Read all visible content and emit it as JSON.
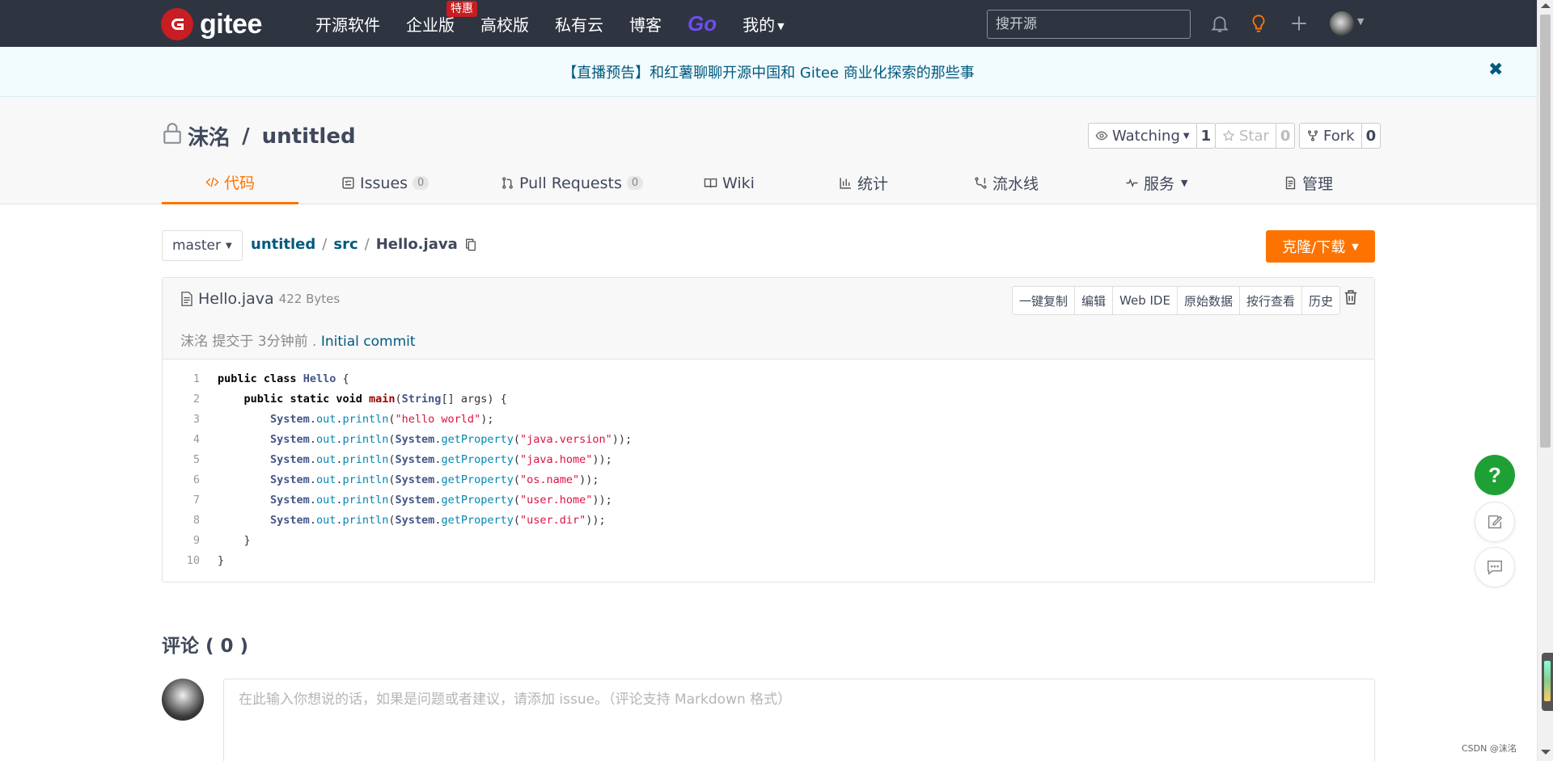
{
  "nav": {
    "logo_text": "gitee",
    "links": [
      "开源软件",
      "企业版",
      "高校版",
      "私有云",
      "博客"
    ],
    "go_label": "Go",
    "mine_label": "我的",
    "hot_badge": "特惠",
    "search_placeholder": "搜开源",
    "icons": [
      "bell-icon",
      "lightbulb-icon",
      "plus-icon",
      "avatar"
    ],
    "accent_color": "#c71d23"
  },
  "banner": {
    "text": "【直播预告】和红薯聊聊开源中国和 Gitee 商业化探索的那些事",
    "close": "✖"
  },
  "repo": {
    "owner": "沫洺",
    "name": "untitled",
    "separator": " / ",
    "watch_label": "Watching",
    "watch_count": "1",
    "star_label": "Star",
    "star_count": "0",
    "fork_label": "Fork",
    "fork_count": "0"
  },
  "tabs": [
    {
      "label": "代码",
      "icon": "code-icon",
      "active": true
    },
    {
      "label": "Issues",
      "icon": "issues-icon",
      "count": "0"
    },
    {
      "label": "Pull Requests",
      "icon": "pull-request-icon",
      "count": "0"
    },
    {
      "label": "Wiki",
      "icon": "book-icon"
    },
    {
      "label": "统计",
      "icon": "bar-chart-icon"
    },
    {
      "label": "流水线",
      "icon": "pipeline-icon"
    },
    {
      "label": "服务",
      "icon": "pulse-icon"
    },
    {
      "label": "管理",
      "icon": "document-icon"
    }
  ],
  "path": {
    "branch": "master",
    "crumbs": [
      "untitled",
      "src"
    ],
    "current": "Hello.java",
    "clone_label": "克隆/下载"
  },
  "file": {
    "name": "Hello.java",
    "size": "422 Bytes",
    "tools": [
      "一键复制",
      "编辑",
      "Web IDE",
      "原始数据",
      "按行查看",
      "历史"
    ],
    "commit_author": "沫洺",
    "commit_text": " 提交于 3分钟前 . ",
    "commit_message": "Initial commit"
  },
  "code_lines": [
    "public class Hello {",
    "    public static void main(String[] args) {",
    "        System.out.println(\"hello world\");",
    "        System.out.println(System.getProperty(\"java.version\"));",
    "        System.out.println(System.getProperty(\"java.home\"));",
    "        System.out.println(System.getProperty(\"os.name\"));",
    "        System.out.println(System.getProperty(\"user.home\"));",
    "        System.out.println(System.getProperty(\"user.dir\"));",
    "    }",
    "}"
  ],
  "comments": {
    "title": "评论 ( 0 )",
    "placeholder": "在此输入你想说的话，如果是问题或者建议，请添加 issue。（评论支持 Markdown 格式）"
  },
  "float": {
    "help": "?"
  },
  "watermark": "CSDN @沫洺"
}
